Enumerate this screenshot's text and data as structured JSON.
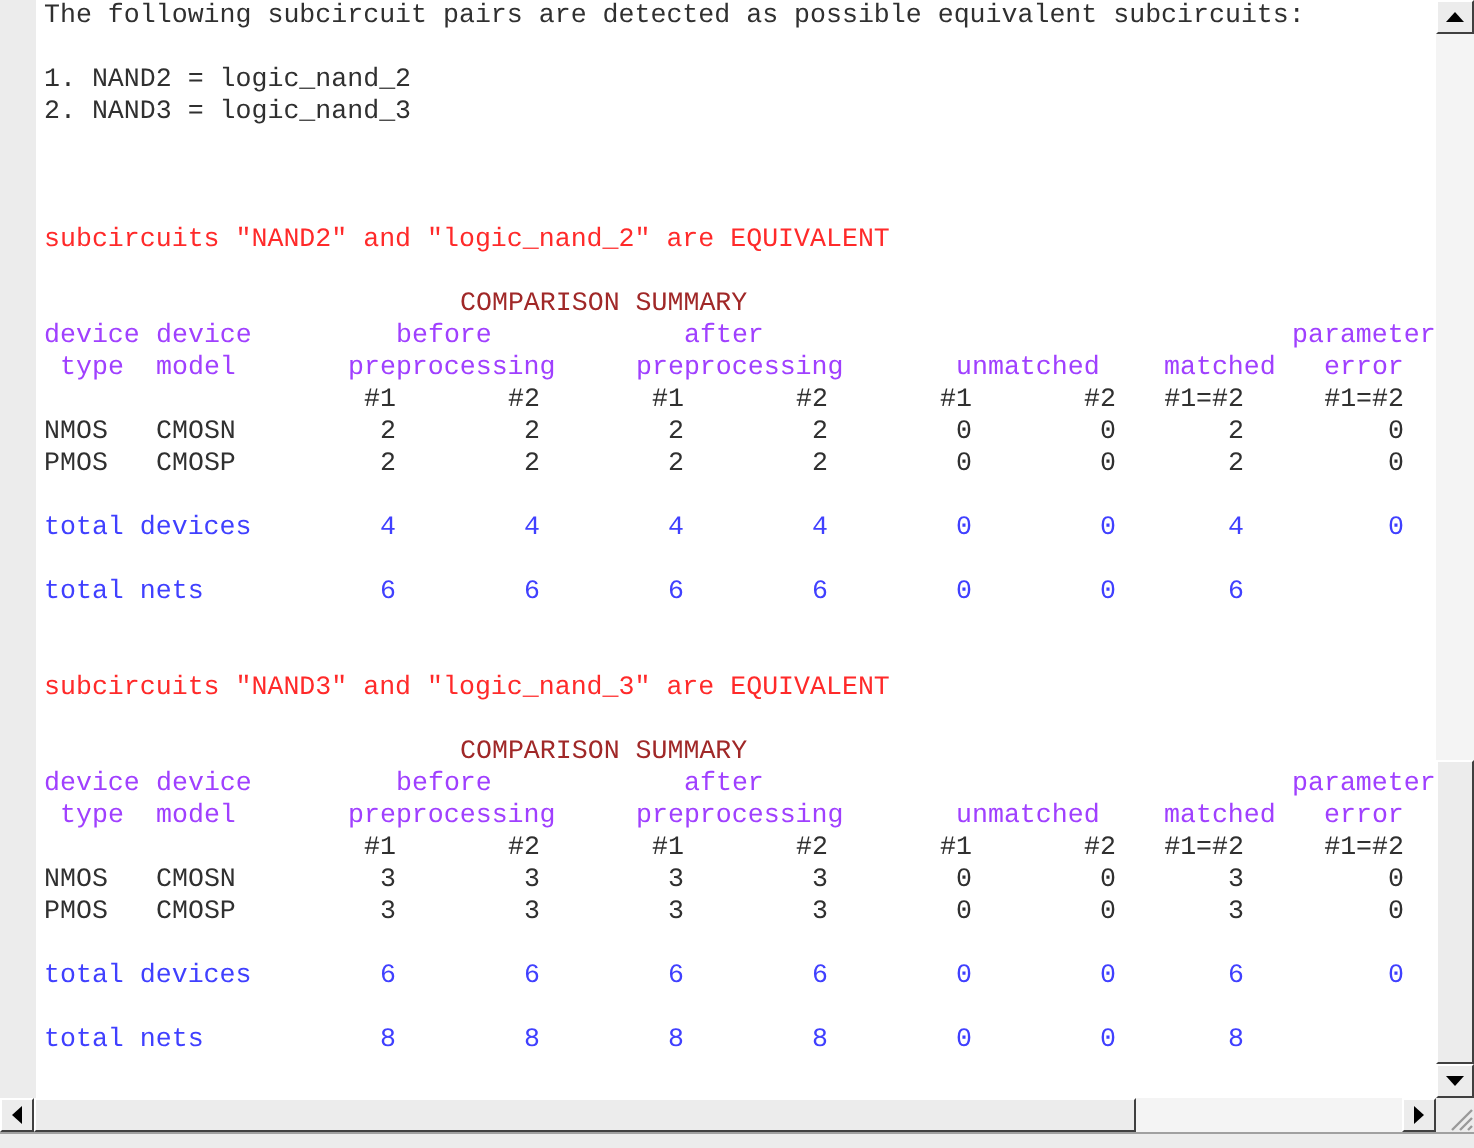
{
  "intro": "The following subcircuit pairs are detected as possible equivalent subcircuits:",
  "pairs": [
    "1. NAND2 = logic_nand_2",
    "2. NAND3 = logic_nand_3"
  ],
  "results": [
    {
      "verdict": "subcircuits \"NAND2\" and \"logic_nand_2\" are EQUIVALENT",
      "summary_title": "COMPARISON SUMMARY",
      "header_line_1": [
        "device",
        "device",
        "before",
        "after",
        "parameter"
      ],
      "header_line_2": [
        "type",
        "model",
        "preprocessing",
        "preprocessing",
        "unmatched",
        "matched",
        "error"
      ],
      "header_line_3": [
        "#1",
        "#2",
        "#1",
        "#2",
        "#1",
        "#2",
        "#1=#2",
        "#1=#2"
      ],
      "devices": [
        {
          "type": "NMOS",
          "model": "CMOSN",
          "counts": [
            "2",
            "2",
            "2",
            "2",
            "0",
            "0",
            "2",
            "0"
          ]
        },
        {
          "type": "PMOS",
          "model": "CMOSP",
          "counts": [
            "2",
            "2",
            "2",
            "2",
            "0",
            "0",
            "2",
            "0"
          ]
        }
      ],
      "totals": [
        {
          "label": "total devices",
          "counts": [
            "4",
            "4",
            "4",
            "4",
            "0",
            "0",
            "4",
            "0"
          ]
        },
        {
          "label": "total nets",
          "counts": [
            "6",
            "6",
            "6",
            "6",
            "0",
            "0",
            "6"
          ]
        }
      ]
    },
    {
      "verdict": "subcircuits \"NAND3\" and \"logic_nand_3\" are EQUIVALENT",
      "summary_title": "COMPARISON SUMMARY",
      "header_line_1": [
        "device",
        "device",
        "before",
        "after",
        "parameter"
      ],
      "header_line_2": [
        "type",
        "model",
        "preprocessing",
        "preprocessing",
        "unmatched",
        "matched",
        "error"
      ],
      "header_line_3": [
        "#1",
        "#2",
        "#1",
        "#2",
        "#1",
        "#2",
        "#1=#2",
        "#1=#2"
      ],
      "devices": [
        {
          "type": "NMOS",
          "model": "CMOSN",
          "counts": [
            "3",
            "3",
            "3",
            "3",
            "0",
            "0",
            "3",
            "0"
          ]
        },
        {
          "type": "PMOS",
          "model": "CMOSP",
          "counts": [
            "3",
            "3",
            "3",
            "3",
            "0",
            "0",
            "3",
            "0"
          ]
        }
      ],
      "totals": [
        {
          "label": "total devices",
          "counts": [
            "6",
            "6",
            "6",
            "6",
            "0",
            "0",
            "6",
            "0"
          ]
        },
        {
          "label": "total nets",
          "counts": [
            "8",
            "8",
            "8",
            "8",
            "0",
            "0",
            "8"
          ]
        }
      ]
    }
  ]
}
